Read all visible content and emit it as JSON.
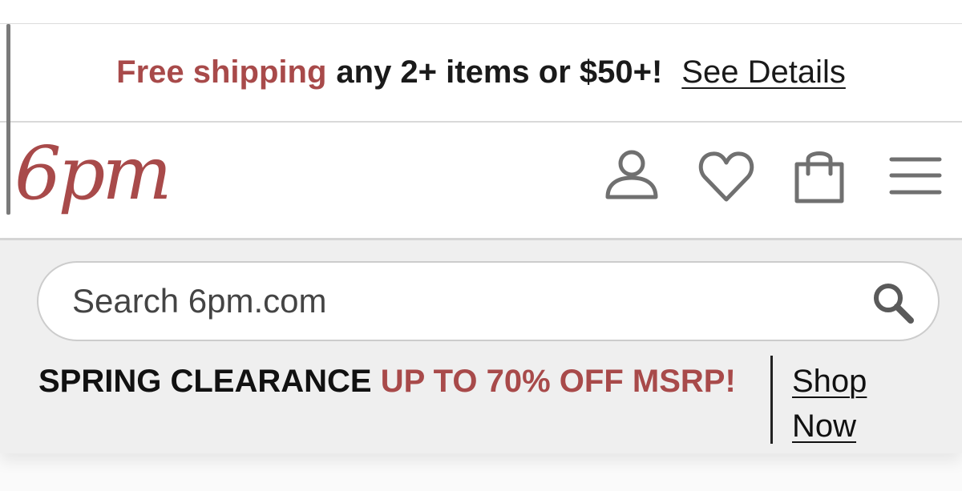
{
  "promo": {
    "highlight": "Free shipping",
    "text": "any 2+ items or $50+!",
    "link": "See Details"
  },
  "header": {
    "logo_text": "6pm",
    "icons": [
      "account-icon",
      "heart-icon",
      "shopping-bag-icon",
      "hamburger-menu-icon"
    ]
  },
  "search": {
    "placeholder": "Search 6pm.com",
    "value": ""
  },
  "banner": {
    "title": "SPRING CLEARANCE",
    "highlight": "UP TO 70% OFF MSRP!",
    "cta": "Shop Now"
  },
  "colors": {
    "accent": "#a84a4a",
    "icon_gray": "#707070",
    "search_zone_bg": "#efefef"
  }
}
